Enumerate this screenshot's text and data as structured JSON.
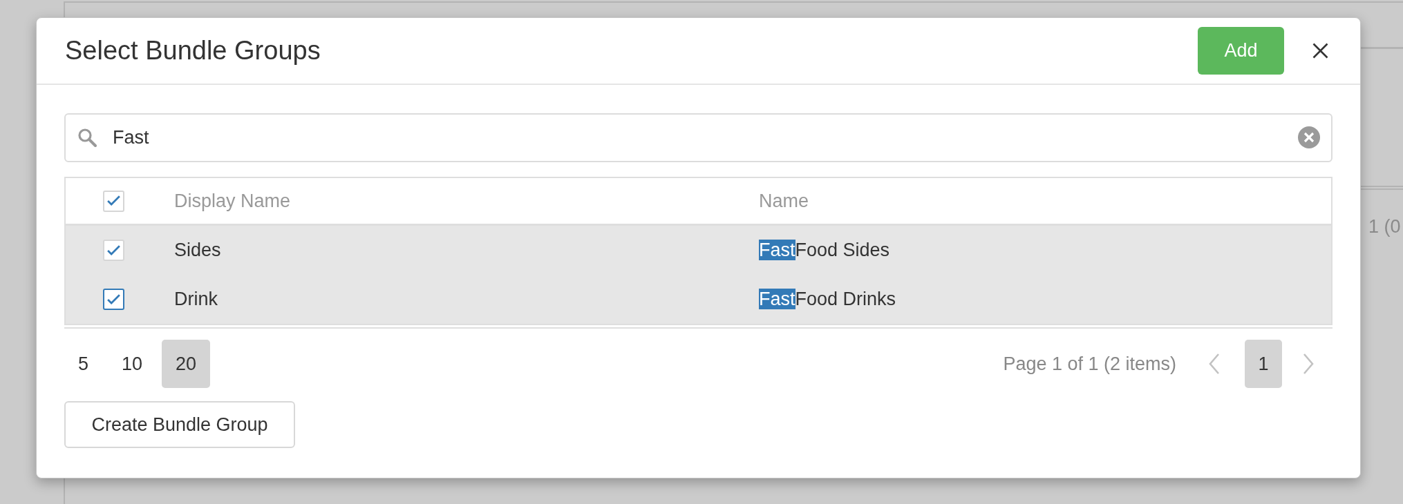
{
  "backdrop": {
    "label": "1 (0"
  },
  "dialog": {
    "title": "Select Bundle Groups",
    "add_button": "Add"
  },
  "search": {
    "value": "Fast"
  },
  "table": {
    "select_all": {
      "checked": true
    },
    "columns": [
      "Display Name",
      "Name"
    ],
    "rows": [
      {
        "selected": true,
        "checked": true,
        "focused": false,
        "display_name": "Sides",
        "name": [
          {
            "text": "Fast",
            "highlighted": true
          },
          {
            "text": "Food Sides",
            "highlighted": false
          }
        ]
      },
      {
        "selected": true,
        "checked": true,
        "focused": true,
        "display_name": "Drink",
        "name": [
          {
            "text": "Fast",
            "highlighted": true
          },
          {
            "text": "Food Drinks",
            "highlighted": false
          }
        ]
      }
    ]
  },
  "pager": {
    "page_sizes": [
      {
        "label": "5",
        "selected": false
      },
      {
        "label": "10",
        "selected": false
      },
      {
        "label": "20",
        "selected": true
      }
    ],
    "summary": "Page 1 of 1 (2 items)",
    "previous": {
      "disabled": true
    },
    "pages": [
      {
        "label": "1",
        "selected": true
      }
    ],
    "next": {
      "disabled": true
    }
  },
  "create_button": "Create Bundle Group"
}
